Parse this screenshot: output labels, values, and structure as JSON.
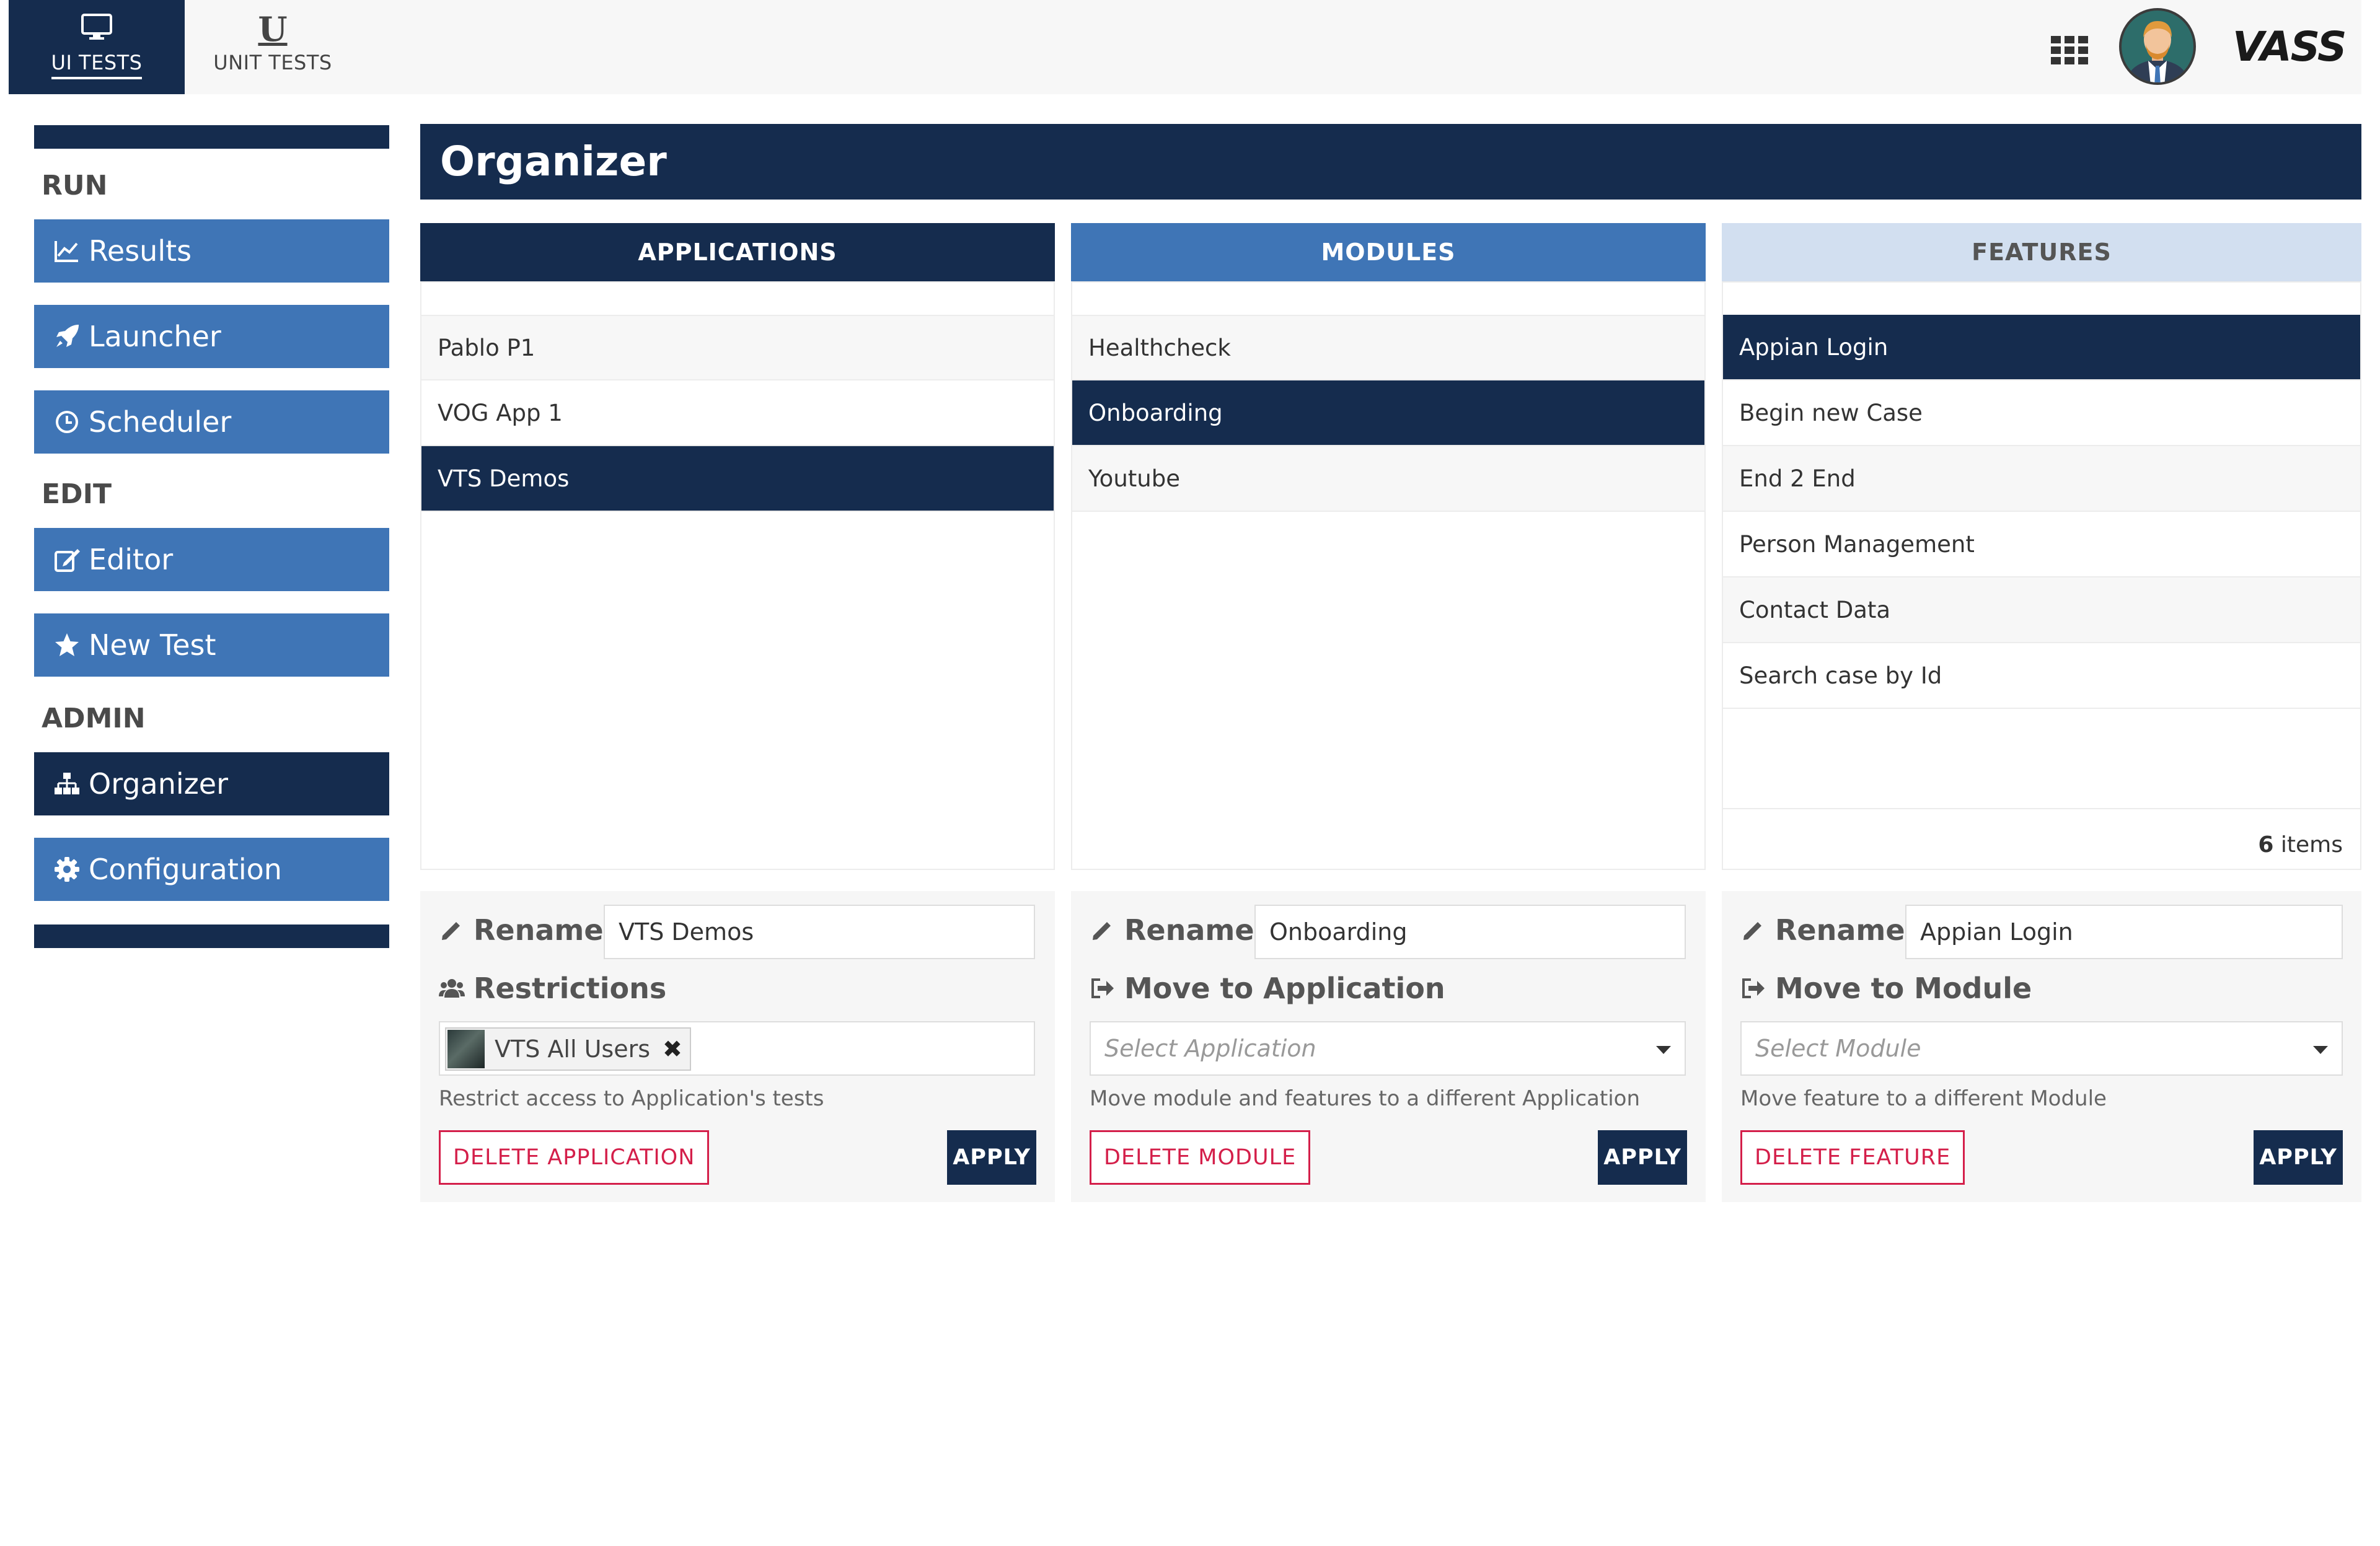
{
  "topnav": {
    "tabs": [
      {
        "label": "UI TESTS",
        "icon": "monitor-icon",
        "active": true
      },
      {
        "label": "UNIT TESTS",
        "icon": "unit-icon",
        "glyph": "U",
        "active": false
      }
    ]
  },
  "header": {
    "apps_icon": "grid-icon",
    "avatar_icon": "user-avatar",
    "brand": "VASS"
  },
  "sidebar": {
    "sections": [
      {
        "title": "RUN",
        "items": [
          {
            "label": "Results",
            "icon": "line-chart-icon"
          },
          {
            "label": "Launcher",
            "icon": "rocket-icon"
          },
          {
            "label": "Scheduler",
            "icon": "clock-icon"
          }
        ]
      },
      {
        "title": "EDIT",
        "items": [
          {
            "label": "Editor",
            "icon": "edit-icon"
          },
          {
            "label": "New Test",
            "icon": "star-icon"
          }
        ]
      },
      {
        "title": "ADMIN",
        "items": [
          {
            "label": "Organizer",
            "icon": "sitemap-icon",
            "active": true
          },
          {
            "label": "Configuration",
            "icon": "gear-icon"
          }
        ]
      }
    ]
  },
  "page": {
    "title": "Organizer"
  },
  "columns": {
    "applications": {
      "header": "APPLICATIONS",
      "items": [
        "Pablo P1",
        "VOG App 1",
        "VTS Demos"
      ],
      "selected_index": 2
    },
    "modules": {
      "header": "MODULES",
      "items": [
        "Healthcheck",
        "Onboarding",
        "Youtube"
      ],
      "selected_index": 1
    },
    "features": {
      "header": "FEATURES",
      "items": [
        "Appian Login",
        "Begin new Case",
        "End 2 End",
        "Person Management",
        "Contact Data",
        "Search case by Id"
      ],
      "selected_index": 0,
      "count": "6",
      "count_suffix": " items"
    }
  },
  "panels": {
    "application": {
      "rename_label": "Rename",
      "rename_value": "VTS Demos",
      "restrictions_label": "Restrictions",
      "tag_label": "VTS All Users",
      "tag_remove": "✖",
      "help": "Restrict access to Application's tests",
      "delete_label": "DELETE APPLICATION",
      "apply_label": "APPLY"
    },
    "module": {
      "rename_label": "Rename",
      "rename_value": "Onboarding",
      "move_label": "Move to Application",
      "select_placeholder": "Select Application",
      "help": "Move module and features to a different Application",
      "delete_label": "DELETE MODULE",
      "apply_label": "APPLY"
    },
    "feature": {
      "rename_label": "Rename",
      "rename_value": "Appian Login",
      "move_label": "Move to Module",
      "select_placeholder": "Select Module",
      "help": "Move feature to a different Module",
      "delete_label": "DELETE FEATURE",
      "apply_label": "APPLY"
    }
  },
  "colors": {
    "navy": "#152c4e",
    "blue": "#3f75b6",
    "light_blue": "#d2dff0",
    "danger": "#d41f4a"
  }
}
